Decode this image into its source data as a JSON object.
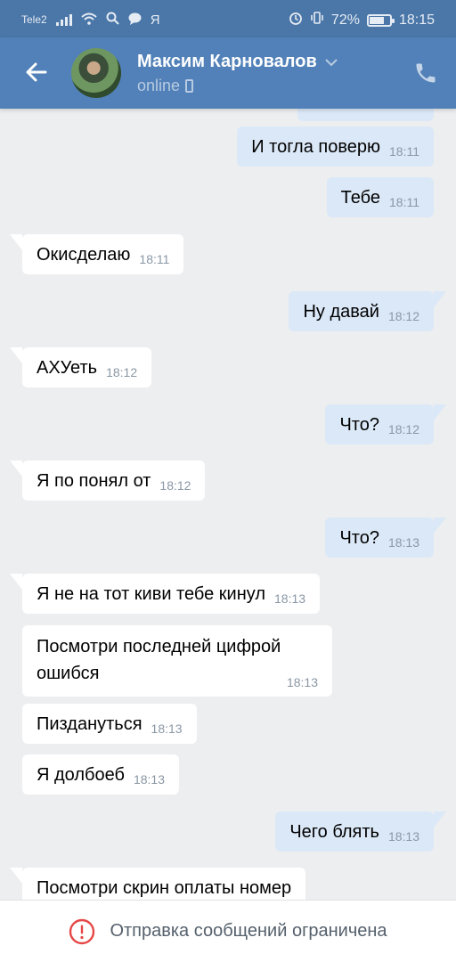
{
  "statusbar": {
    "carrier": "Tele2",
    "ya": "Я",
    "battery_percent": "72%",
    "battery_level": 0.72,
    "time": "18:15"
  },
  "header": {
    "name": "Максим Карновалов",
    "status": "online"
  },
  "colors": {
    "header": "#5181b8",
    "statusbar": "#4a76a8",
    "incoming": "#ffffff",
    "outgoing": "#dbe8f7",
    "warning": "#e64646"
  },
  "messages": [
    {
      "dir": "out",
      "text": "И тогла поверю",
      "time": "18:11"
    },
    {
      "dir": "out",
      "text": "Тебе",
      "time": "18:11"
    },
    {
      "dir": "in",
      "text": "Окисделаю",
      "time": "18:11"
    },
    {
      "dir": "out",
      "text": "Ну давай",
      "time": "18:12"
    },
    {
      "dir": "in",
      "text": "АХУеть",
      "time": "18:12"
    },
    {
      "dir": "out",
      "text": "Что?",
      "time": "18:12"
    },
    {
      "dir": "in",
      "text": "Я по понял от",
      "time": "18:12"
    },
    {
      "dir": "out",
      "text": "Что?",
      "time": "18:13"
    },
    {
      "dir": "in",
      "text": "Я не на тот киви тебе кинул",
      "time": "18:13"
    },
    {
      "dir": "in",
      "text": "Посмотри последней цифрой ошибся",
      "time": "18:13"
    },
    {
      "dir": "in",
      "text": "Пиздануться",
      "time": "18:13"
    },
    {
      "dir": "in",
      "text": "Я долбоеб",
      "time": "18:13"
    },
    {
      "dir": "out",
      "text": "Чего блять",
      "time": "18:13"
    },
    {
      "dir": "in",
      "text": "Посмотри скрин оплаты номер",
      "time": ""
    }
  ],
  "footer": {
    "text": "Отправка сообщений ограничена",
    "icon": "alert-circle-icon"
  }
}
